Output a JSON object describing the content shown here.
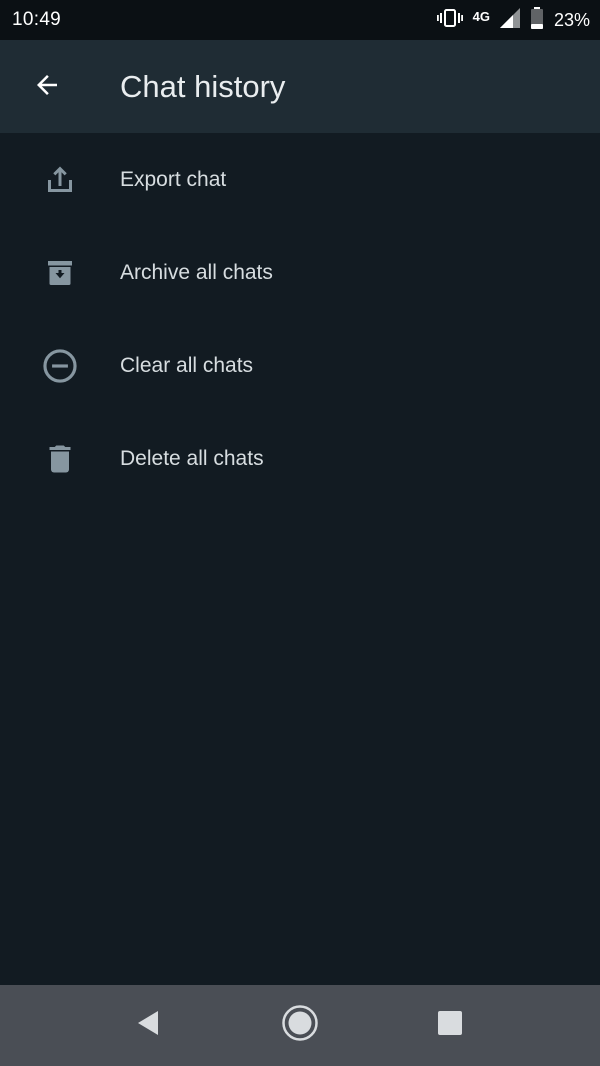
{
  "status_bar": {
    "time": "10:49",
    "network": "4G",
    "battery": "23%",
    "icons": [
      "vibrate-icon",
      "signal-icon",
      "battery-icon"
    ]
  },
  "app_bar": {
    "title": "Chat history",
    "back_icon": "arrow-left-icon"
  },
  "menu": {
    "items": [
      {
        "label": "Export chat",
        "icon": "upload-icon"
      },
      {
        "label": "Archive all chats",
        "icon": "archive-icon"
      },
      {
        "label": "Clear all chats",
        "icon": "minus-circle-icon"
      },
      {
        "label": "Delete all chats",
        "icon": "trash-icon"
      }
    ]
  },
  "nav_bar": {
    "icons": [
      "nav-back-icon",
      "nav-home-icon",
      "nav-recents-icon"
    ]
  },
  "colors": {
    "background": "#121b22",
    "app_bar": "#1f2c34",
    "text": "#e9edef",
    "icon": "#8696a0",
    "nav_bar": "#4a4e55"
  }
}
